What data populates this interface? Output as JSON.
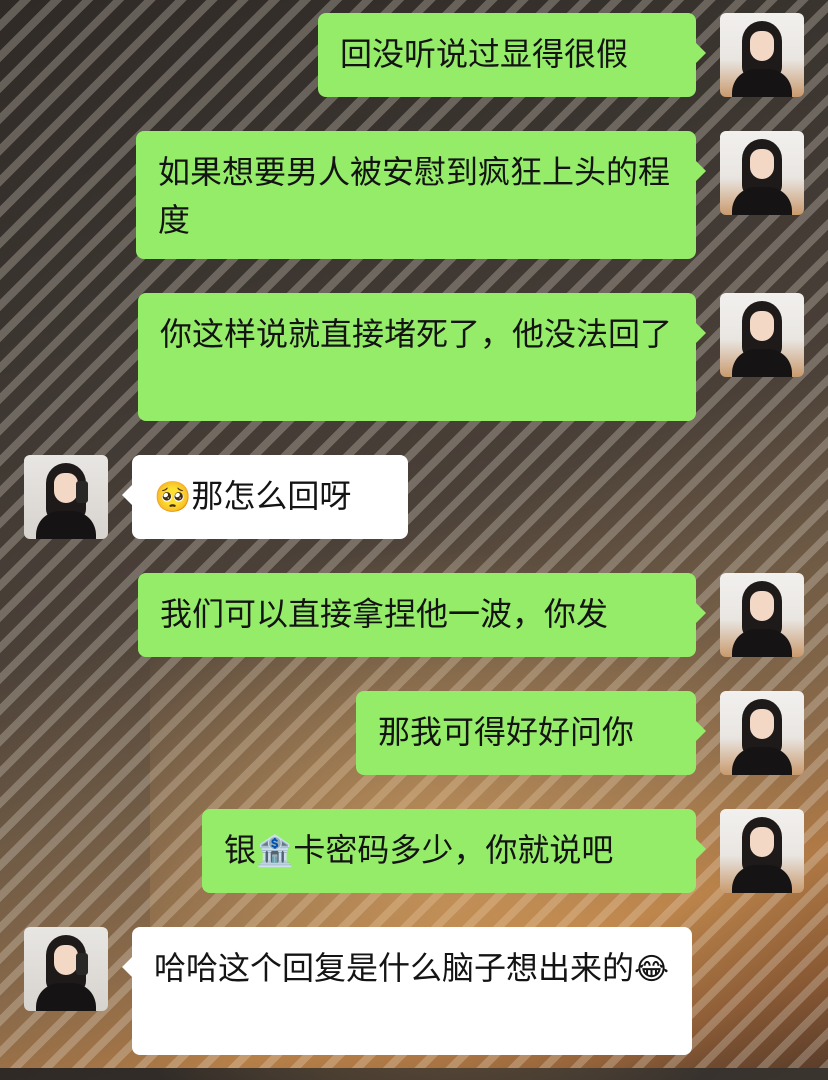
{
  "messages": [
    {
      "from": "me",
      "text": "回没听说过显得很假"
    },
    {
      "from": "me",
      "text": "如果想要男人被安慰到疯狂上头的程度"
    },
    {
      "from": "me",
      "text": "你这样说就直接堵死了，他没法回了"
    },
    {
      "from": "them",
      "text": "那怎么回呀",
      "emoji": "🥺"
    },
    {
      "from": "me",
      "text": "我们可以直接拿捏他一波，你发"
    },
    {
      "from": "me",
      "text": "那我可得好好问你"
    },
    {
      "from": "me",
      "text_before": "银",
      "emoji": "🏦",
      "text_after": "卡密码多少，你就说吧"
    },
    {
      "from": "them",
      "text": "哈哈这个回复是什么脑子想出来的",
      "emoji": "😂"
    }
  ]
}
